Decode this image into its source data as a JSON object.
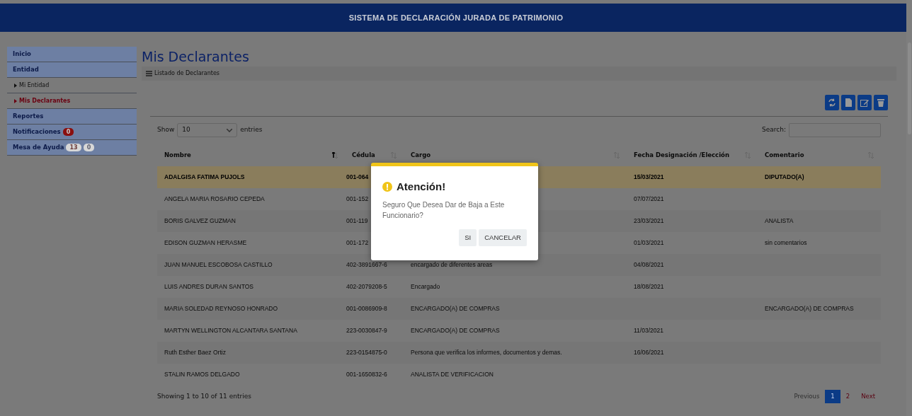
{
  "header": {
    "title": "SISTEMA DE DECLARACIÓN JURADA DE PATRIMONIO"
  },
  "sidebar": {
    "items": [
      {
        "label": "Inicio",
        "kind": "section"
      },
      {
        "label": "Entidad",
        "kind": "section"
      },
      {
        "label": "Mi Entidad",
        "kind": "sub",
        "selected": false
      },
      {
        "label": "Mis Declarantes",
        "kind": "sub",
        "selected": true
      },
      {
        "label": "Reportes",
        "kind": "section"
      },
      {
        "label": "Notificaciones",
        "kind": "section",
        "badges": [
          {
            "text": "0",
            "color": "#8a0f0f"
          }
        ]
      },
      {
        "label": "Mesa de Ayuda",
        "kind": "section",
        "badges": [
          {
            "text": "13",
            "color": "#6a3a3a"
          },
          {
            "text": "0",
            "color": "#5e6070"
          }
        ]
      }
    ]
  },
  "page": {
    "title": "Mis Declarantes",
    "panel_heading": "Listado de Declarantes"
  },
  "toolbar": {
    "buttons": [
      {
        "kind": "refresh"
      },
      {
        "kind": "file"
      },
      {
        "kind": "edit"
      },
      {
        "kind": "delete"
      }
    ]
  },
  "length": {
    "label_before": "Show",
    "value": "10",
    "label_after": "entries"
  },
  "search": {
    "label": "Search:"
  },
  "table": {
    "columns": [
      {
        "label": "Nombre",
        "sorted": true
      },
      {
        "label": "Cédula",
        "sorted": false
      },
      {
        "label": "Cargo",
        "sorted": false
      },
      {
        "label": "Fecha Designación /Elección",
        "sorted": false
      },
      {
        "label": "Comentario",
        "sorted": false
      }
    ],
    "rows": [
      {
        "selected": true,
        "nombre": "ADALGISA FATIMA PUJOLS",
        "cedula": "001-064",
        "fecha": "15/03/2021",
        "comentario": "DIPUTADO(A)"
      },
      {
        "selected": false,
        "nombre": "ANGELA MARIA ROSARIO CEPEDA",
        "cedula": "001-152",
        "fecha": "07/07/2021"
      },
      {
        "selected": false,
        "nombre": "BORIS GALVEZ GUZMAN",
        "cedula": "001-119",
        "fecha": "23/03/2021",
        "comentario": "ANALISTA"
      },
      {
        "selected": false,
        "nombre": "EDISON GUZMAN HERASME",
        "cedula": "001-172",
        "fecha": "01/03/2021",
        "comentario": "sin comentarios"
      },
      {
        "selected": false,
        "nombre": "JUAN MANUEL ESCOBOSA CASTILLO",
        "cedula": "402-3891667-6",
        "cargo": "encargado de diferentes areas",
        "fecha": "04/08/2021"
      },
      {
        "selected": false,
        "nombre": "LUIS ANDRES DURAN SANTOS",
        "cedula": "402-2079208-5",
        "cargo": "Encargado",
        "fecha": "18/08/2021"
      },
      {
        "selected": false,
        "nombre": "MARIA SOLEDAD REYNOSO HONRADO",
        "cedula": "001-0086909-8",
        "cargo": "ENCARGADO(A) DE COMPRAS",
        "comentario": "ENCARGADO(A) DE COMPRAS"
      },
      {
        "selected": false,
        "nombre": "MARTYN WELLINGTON ALCANTARA SANTANA",
        "cedula": "223-0030847-9",
        "cargo": "ENCARGADO(A) DE COMPRAS",
        "fecha": "11/03/2021"
      },
      {
        "selected": false,
        "nombre": "Ruth Esther Baez Ortiz",
        "cedula": "223-0154875-0",
        "cargo": "Persona que verifica los informes, documentos y demas.",
        "fecha": "16/06/2021"
      },
      {
        "selected": false,
        "nombre": "STALIN RAMOS DELGADO",
        "cedula": "001-1650832-6",
        "cargo": "ANALISTA DE VERIFICACION"
      }
    ]
  },
  "info": "Showing 1 to 10 of 11 entries",
  "pagination": [
    {
      "label": "Previous",
      "selected": false,
      "disabled": true
    },
    {
      "label": "1",
      "selected": true,
      "disabled": false
    },
    {
      "label": "2",
      "selected": false,
      "disabled": false
    },
    {
      "label": "Next",
      "selected": false,
      "disabled": false
    }
  ],
  "modal": {
    "title": "Atención!",
    "message": "Seguro Que Desea Dar de Baja a Este Funcionario?",
    "buttons": [
      "SI",
      "CANCELAR"
    ]
  }
}
